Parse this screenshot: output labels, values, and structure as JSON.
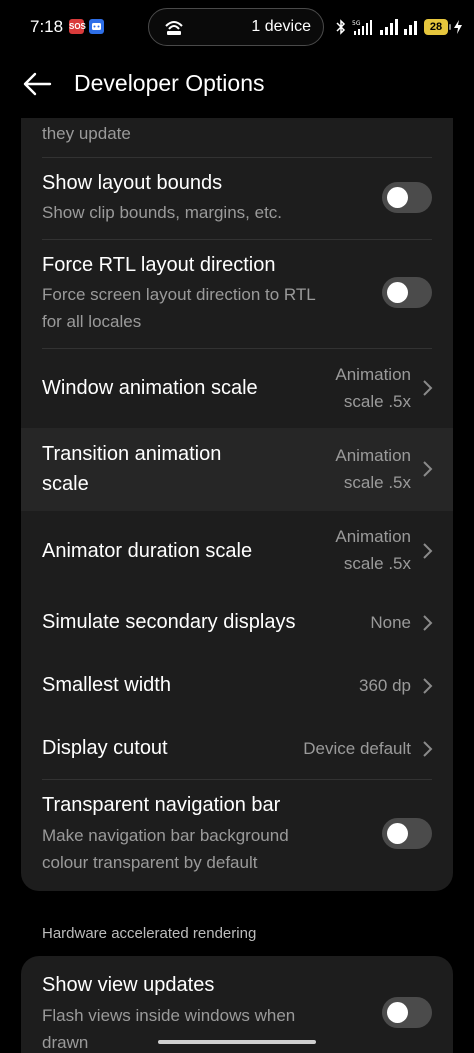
{
  "status_bar": {
    "time": "7:18",
    "notif_sos": "SOS",
    "pill_text": "1 device",
    "battery": "28"
  },
  "header": {
    "title": "Developer Options"
  },
  "settings": {
    "partial_sub": "they update",
    "show_layout_bounds": {
      "title": "Show layout bounds",
      "sub": "Show clip bounds, margins, etc.",
      "enabled": false
    },
    "force_rtl": {
      "title": "Force RTL layout direction",
      "sub_line1": "Force screen layout direction to RTL",
      "sub_line2": "for all locales",
      "enabled": false
    },
    "window_anim": {
      "title": "Window animation scale",
      "val_line1": "Animation",
      "val_line2": "scale .5x"
    },
    "transition_anim": {
      "title_line1": "Transition animation",
      "title_line2": "scale",
      "val_line1": "Animation",
      "val_line2": "scale .5x"
    },
    "animator_duration": {
      "title": "Animator duration scale",
      "val_line1": "Animation",
      "val_line2": "scale .5x"
    },
    "secondary_displays": {
      "title": "Simulate secondary displays",
      "value": "None"
    },
    "smallest_width": {
      "title": "Smallest width",
      "value": "360 dp"
    },
    "display_cutout": {
      "title": "Display cutout",
      "value": "Device default"
    },
    "transparent_nav": {
      "title": "Transparent navigation bar",
      "sub_line1": "Make navigation bar background",
      "sub_line2": "colour transparent by default",
      "enabled": false
    }
  },
  "section_header": "Hardware accelerated rendering",
  "hw_settings": {
    "show_view_updates": {
      "title": "Show view updates",
      "sub_line1": "Flash views inside windows when",
      "sub_line2": "drawn",
      "enabled": false
    }
  },
  "colors": {
    "background": "#000000",
    "card": "#1d1d1d",
    "highlight": "#262626",
    "secondary_text": "#9a9a9a",
    "toggle_off": "#4b4b4b"
  }
}
